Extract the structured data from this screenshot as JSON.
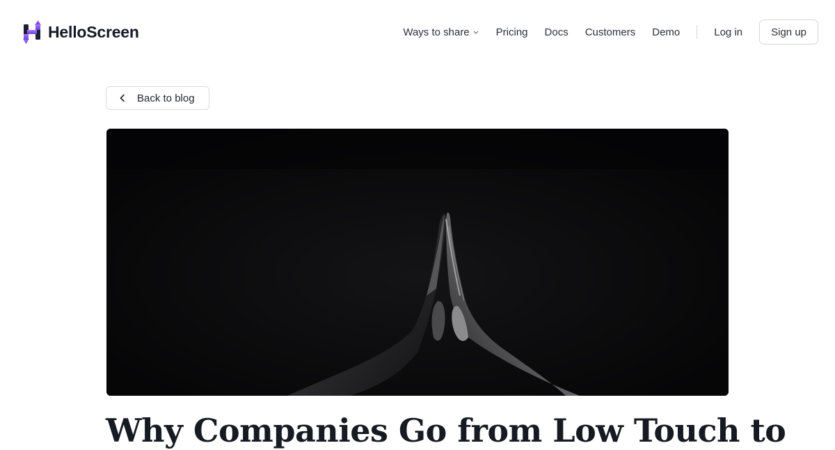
{
  "brand": {
    "name": "HelloScreen",
    "logo_icon": "helloscreen-logo-icon",
    "accent_color": "#7b4fe0"
  },
  "nav": {
    "ways_to_share": "Ways to share",
    "pricing": "Pricing",
    "docs": "Docs",
    "customers": "Customers",
    "demo": "Demo",
    "login": "Log in",
    "signup": "Sign up"
  },
  "back_button": {
    "label": "Back to blog",
    "icon": "chevron-left-icon"
  },
  "hero_image": {
    "description_icon": "praying-hands-image"
  },
  "article": {
    "title": "Why Companies Go from Low Touch to"
  }
}
